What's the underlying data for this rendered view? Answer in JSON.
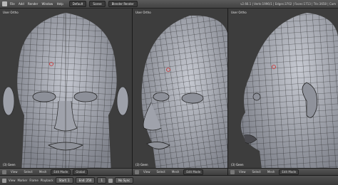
{
  "app": {
    "menu": [
      "File",
      "Add",
      "Render",
      "Window",
      "Help"
    ],
    "layout": "Default",
    "scene": "Scene",
    "engine": "Blender Render",
    "info": "v2.66.1 | Verts:1996/1 | Edges:3702 | Faces:1713 | Tris:3658 | Cam"
  },
  "viewports": [
    {
      "label": "User Ortho",
      "object": "(3) Geen",
      "mode": "Edit Mode",
      "menus": [
        "View",
        "Select",
        "Mesh"
      ],
      "pivot": "Global"
    },
    {
      "label": "User Ortho",
      "object": "(3) Geen",
      "mode": "Edit Mode",
      "menus": [
        "View",
        "Select",
        "Mesh"
      ]
    },
    {
      "label": "User Ortho",
      "object": "(3) Geen",
      "mode": "Edit Mode",
      "menus": [
        "View",
        "Select",
        "Mesh"
      ]
    }
  ],
  "timeline": {
    "menus": [
      "View",
      "Marker",
      "Frame",
      "Playback"
    ],
    "start": "Start: 1",
    "end": "End: 250",
    "frame": "1",
    "sync": "No Sync"
  },
  "colors": {
    "mesh": "#a9acb6",
    "wire": "#1e1e1e",
    "bg": "#3d3d3d"
  }
}
